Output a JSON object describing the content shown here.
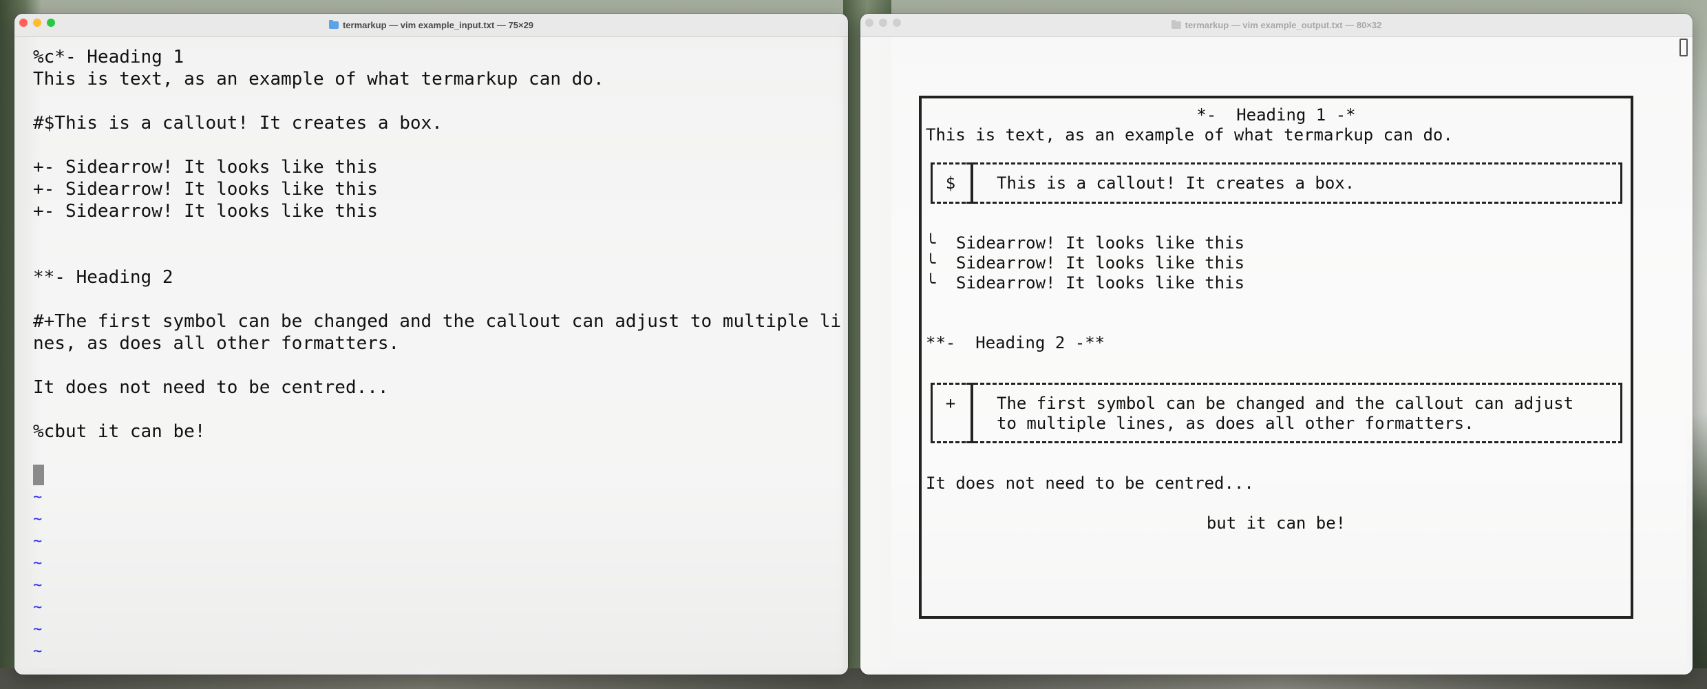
{
  "left_window": {
    "title": "termarkup — vim example_input.txt — 75×29",
    "lines": [
      "%c*- Heading 1",
      "This is text, as an example of what termarkup can do.",
      "",
      "#$This is a callout! It creates a box.",
      "",
      "+- Sidearrow! It looks like this",
      "+- Sidearrow! It looks like this",
      "+- Sidearrow! It looks like this",
      "",
      "",
      "**- Heading 2",
      "",
      "#+The first symbol can be changed and the callout can adjust to multiple li",
      "nes, as does all other formatters.",
      "",
      "It does not need to be centred...",
      "",
      "%cbut it can be!"
    ],
    "tilde": "~",
    "tilde_count": 8
  },
  "right_window": {
    "title": "termarkup — vim example_output.txt — 80×32",
    "heading1": "*-  Heading 1 -*",
    "text": "This is text, as an example of what termarkup can do.",
    "callout1": {
      "symbol": "$",
      "text": "This is a callout! It creates a box."
    },
    "sidearrow_glyph": "╰",
    "sidearrows": [
      "Sidearrow! It looks like this",
      "Sidearrow! It looks like this",
      "Sidearrow! It looks like this"
    ],
    "heading2": "**-  Heading 2 -**",
    "callout2": {
      "symbol": "+",
      "line1": "The first symbol can be changed and the callout can adjust",
      "line2": "to multiple lines, as does all other formatters."
    },
    "not_centred": "It does not need to be centred...",
    "centred": "but it can be!"
  },
  "colors": {
    "close": "#ff5f57",
    "minimize": "#febc2e",
    "zoom": "#28c840",
    "inactive_dot": "#cfcfcf",
    "tilde": "#2a2aee"
  }
}
